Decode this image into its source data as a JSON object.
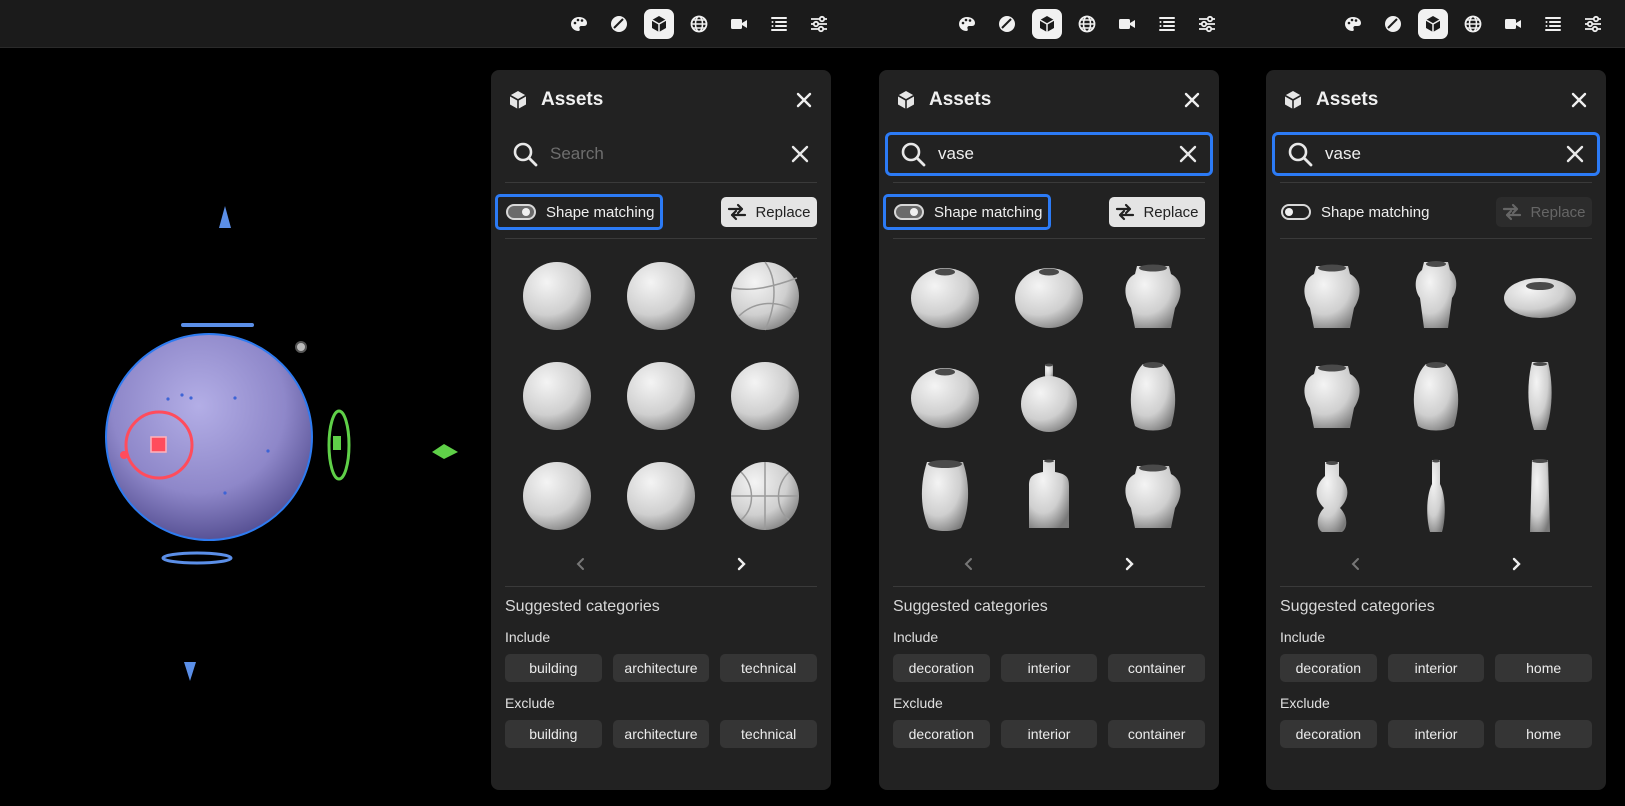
{
  "toolbar_icons": [
    "palette-icon",
    "brush-icon",
    "cube-icon",
    "globe-icon",
    "camera-icon",
    "list-icon",
    "sliders-icon"
  ],
  "active_tool": "cube-icon",
  "panels": [
    {
      "title": "Assets",
      "search_value": "",
      "search_placeholder": "Search",
      "search_focused": false,
      "shape_matching_label": "Shape matching",
      "shape_matching_on": true,
      "shape_matching_focused": true,
      "replace_label": "Replace",
      "replace_enabled": true,
      "results": [
        "sphere",
        "sphere",
        "volleyball",
        "sphere",
        "sphere",
        "sphere",
        "sphere",
        "sphere",
        "basketball"
      ],
      "suggested_title": "Suggested categories",
      "include_label": "Include",
      "include": [
        "building",
        "architecture",
        "technical"
      ],
      "exclude_label": "Exclude",
      "exclude": [
        "building",
        "architecture",
        "technical"
      ]
    },
    {
      "title": "Assets",
      "search_value": "vase",
      "search_placeholder": "Search",
      "search_focused": true,
      "shape_matching_label": "Shape matching",
      "shape_matching_on": true,
      "shape_matching_focused": true,
      "replace_label": "Replace",
      "replace_enabled": true,
      "results": [
        "round-vase",
        "round-vase",
        "urn-vase",
        "round-vase",
        "bud-vase",
        "egg-vase",
        "tall-vase",
        "bottle-vase",
        "urn-vase"
      ],
      "suggested_title": "Suggested categories",
      "include_label": "Include",
      "include": [
        "decoration",
        "interior",
        "container"
      ],
      "exclude_label": "Exclude",
      "exclude": [
        "decoration",
        "interior",
        "container"
      ]
    },
    {
      "title": "Assets",
      "search_value": "vase",
      "search_placeholder": "Search",
      "search_focused": true,
      "shape_matching_label": "Shape matching",
      "shape_matching_on": false,
      "shape_matching_focused": false,
      "replace_label": "Replace",
      "replace_enabled": false,
      "results": [
        "urn-vase",
        "tall-urn-vase",
        "bowl-vase",
        "urn-vase",
        "egg-vase",
        "slim-vase",
        "amphora-vase",
        "thin-vase",
        "cylinder-vase"
      ],
      "suggested_title": "Suggested categories",
      "include_label": "Include",
      "include": [
        "decoration",
        "interior",
        "home"
      ],
      "exclude_label": "Exclude",
      "exclude": [
        "decoration",
        "interior",
        "home"
      ]
    }
  ]
}
